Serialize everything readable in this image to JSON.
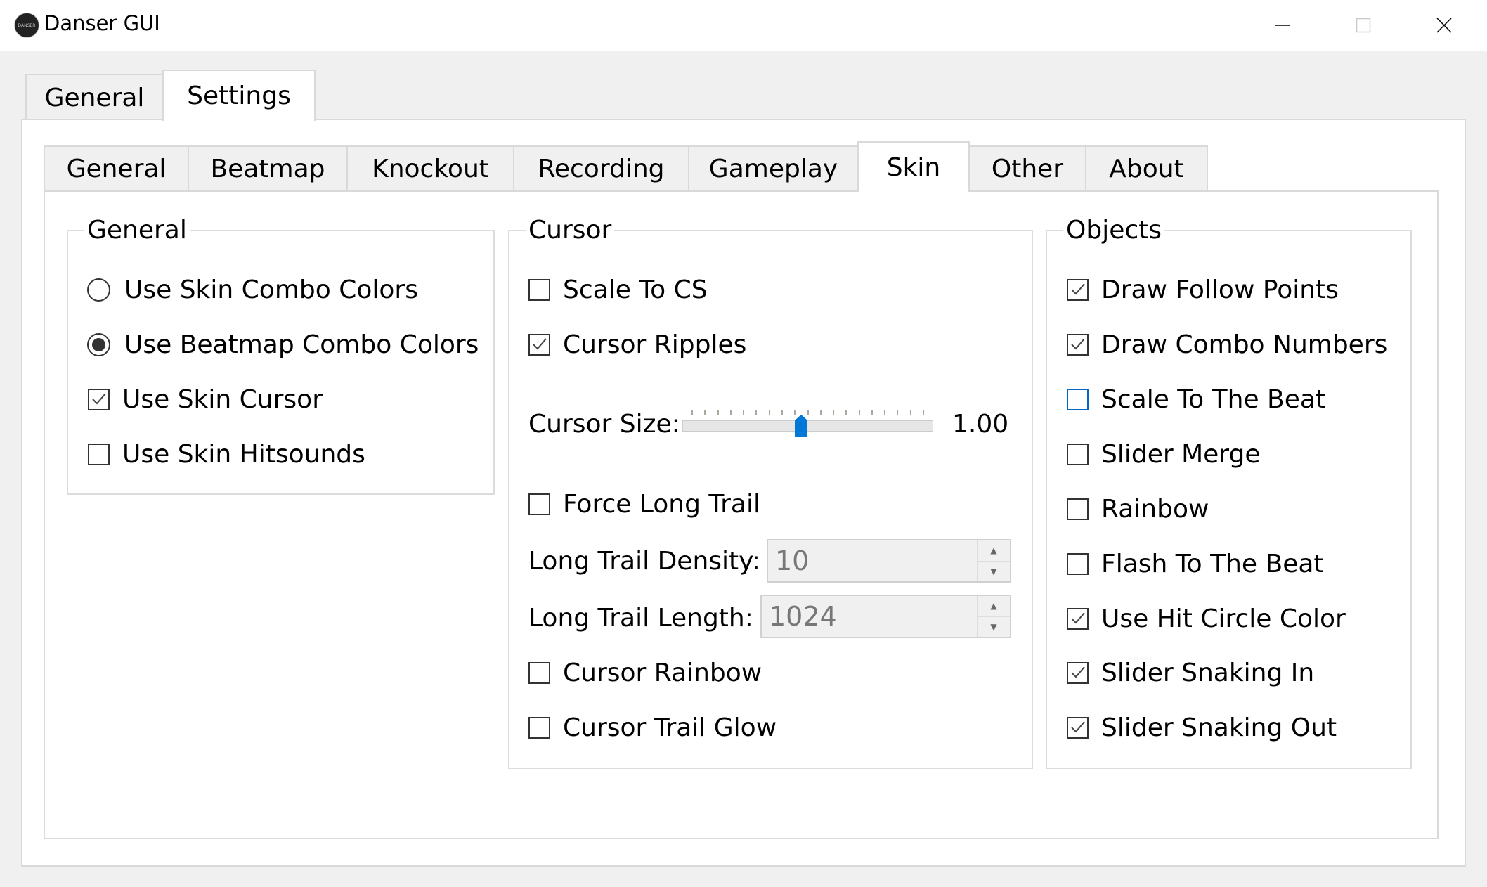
{
  "window": {
    "title": "Danser GUI",
    "icon_text": "DANSER",
    "controls": [
      "minimize",
      "maximize",
      "close"
    ]
  },
  "outer_tabs": [
    {
      "label": "General",
      "active": false
    },
    {
      "label": "Settings",
      "active": true
    }
  ],
  "inner_tabs": [
    {
      "label": "General",
      "active": false
    },
    {
      "label": "Beatmap",
      "active": false
    },
    {
      "label": "Knockout",
      "active": false
    },
    {
      "label": "Recording",
      "active": false
    },
    {
      "label": "Gameplay",
      "active": false
    },
    {
      "label": "Skin",
      "active": true
    },
    {
      "label": "Other",
      "active": false
    },
    {
      "label": "About",
      "active": false
    }
  ],
  "general_group": {
    "title": "General",
    "radios": [
      {
        "label": "Use Skin Combo Colors",
        "selected": false
      },
      {
        "label": "Use Beatmap Combo Colors",
        "selected": true
      }
    ],
    "checkboxes": [
      {
        "label": "Use Skin Cursor",
        "checked": true
      },
      {
        "label": "Use Skin Hitsounds",
        "checked": false
      }
    ]
  },
  "cursor_group": {
    "title": "Cursor",
    "scale_to_cs": {
      "label": "Scale To CS",
      "checked": false
    },
    "cursor_ripples": {
      "label": "Cursor Ripples",
      "checked": true
    },
    "cursor_size": {
      "label": "Cursor Size:",
      "value": "1.00",
      "slider_fraction": 0.47,
      "tick_count": 19
    },
    "force_long_trail": {
      "label": "Force Long Trail",
      "checked": false
    },
    "long_trail_density": {
      "label": "Long Trail Density:",
      "value": "10",
      "enabled": false
    },
    "long_trail_length": {
      "label": "Long Trail Length:",
      "value": "1024",
      "enabled": false
    },
    "cursor_rainbow": {
      "label": "Cursor Rainbow",
      "checked": false
    },
    "cursor_trail_glow": {
      "label": "Cursor Trail Glow",
      "checked": false
    }
  },
  "objects_group": {
    "title": "Objects",
    "checkboxes": [
      {
        "label": "Draw Follow Points",
        "checked": true,
        "focused": false
      },
      {
        "label": "Draw Combo Numbers",
        "checked": true,
        "focused": false
      },
      {
        "label": "Scale To The Beat",
        "checked": false,
        "focused": true
      },
      {
        "label": "Slider Merge",
        "checked": false,
        "focused": false
      },
      {
        "label": "Rainbow",
        "checked": false,
        "focused": false
      },
      {
        "label": "Flash To The Beat",
        "checked": false,
        "focused": false
      },
      {
        "label": "Use Hit Circle Color",
        "checked": true,
        "focused": false
      },
      {
        "label": "Slider Snaking In",
        "checked": true,
        "focused": false
      },
      {
        "label": "Slider Snaking Out",
        "checked": true,
        "focused": false
      }
    ]
  },
  "colors": {
    "accent": "#0078d7",
    "focus_border": "#0067c0",
    "window_bg": "#f0f0f0",
    "pane_bg": "#ffffff",
    "border": "#d9d9d9"
  }
}
